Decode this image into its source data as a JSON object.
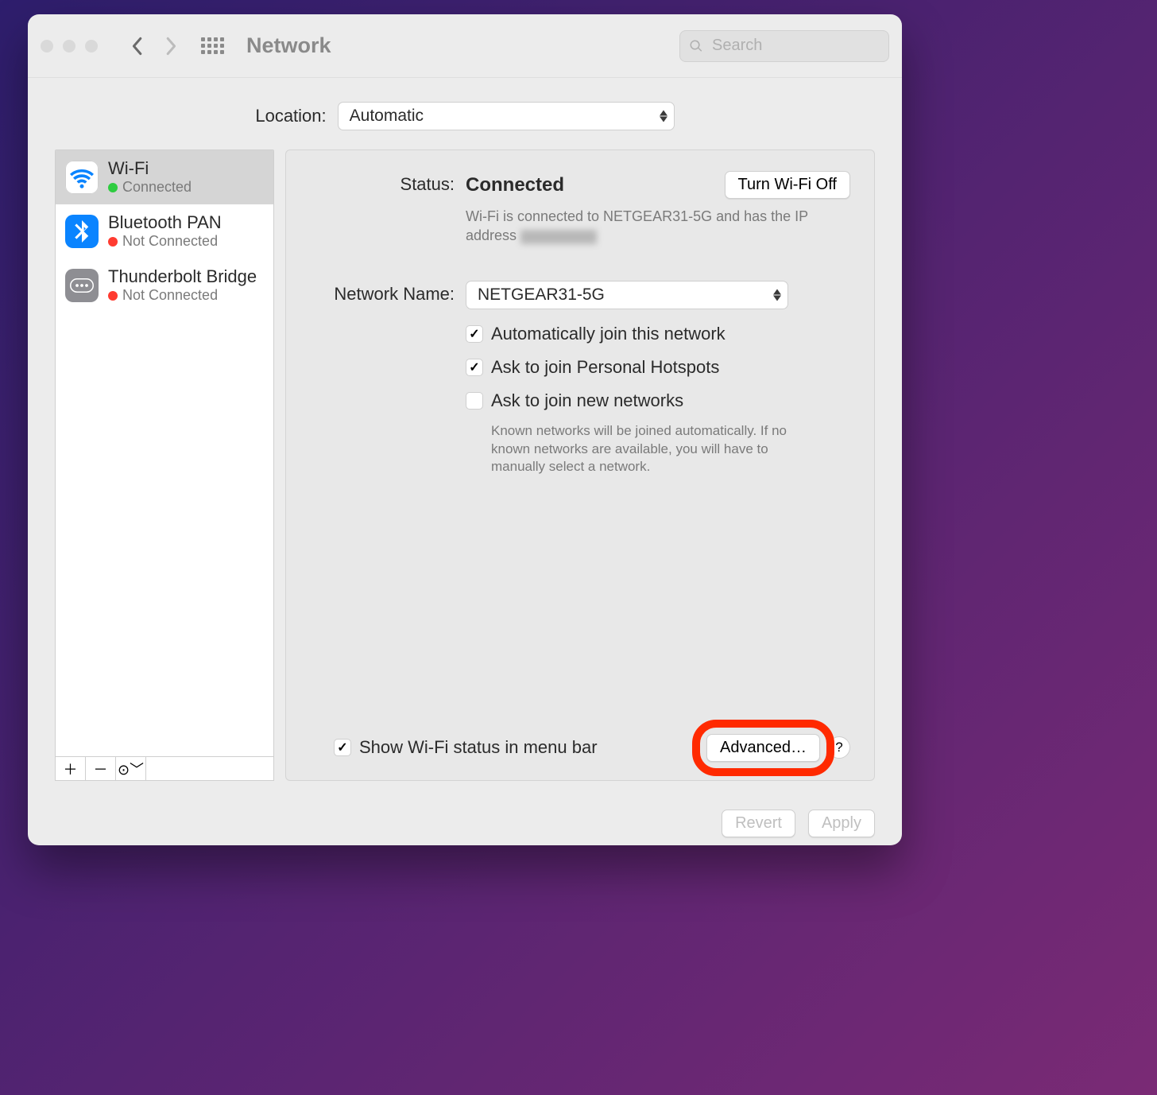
{
  "toolbar": {
    "title": "Network",
    "search_placeholder": "Search"
  },
  "location": {
    "label": "Location:",
    "value": "Automatic"
  },
  "sidebar": {
    "services": [
      {
        "name": "Wi-Fi",
        "status": "Connected",
        "color": "green",
        "icon": "wifi",
        "selected": true
      },
      {
        "name": "Bluetooth PAN",
        "status": "Not Connected",
        "color": "red",
        "icon": "bt",
        "selected": false
      },
      {
        "name": "Thunderbolt Bridge",
        "status": "Not Connected",
        "color": "red",
        "icon": "tb",
        "selected": false
      }
    ]
  },
  "details": {
    "status_label": "Status:",
    "status_value": "Connected",
    "toggle_button": "Turn Wi-Fi Off",
    "status_desc_prefix": "Wi-Fi is connected to NETGEAR31-5G and has the IP address ",
    "network_name_label": "Network Name:",
    "network_name_value": "NETGEAR31-5G",
    "checkboxes": {
      "auto_join": {
        "label": "Automatically join this network",
        "checked": true
      },
      "ask_hotspot": {
        "label": "Ask to join Personal Hotspots",
        "checked": true
      },
      "ask_new": {
        "label": "Ask to join new networks",
        "checked": false
      }
    },
    "help_text": "Known networks will be joined automatically. If no known networks are available, you will have to manually select a network.",
    "show_menu_bar": {
      "label": "Show Wi-Fi status in menu bar",
      "checked": true
    },
    "advanced_button": "Advanced…",
    "help_button": "?"
  },
  "footer": {
    "revert": "Revert",
    "apply": "Apply"
  }
}
